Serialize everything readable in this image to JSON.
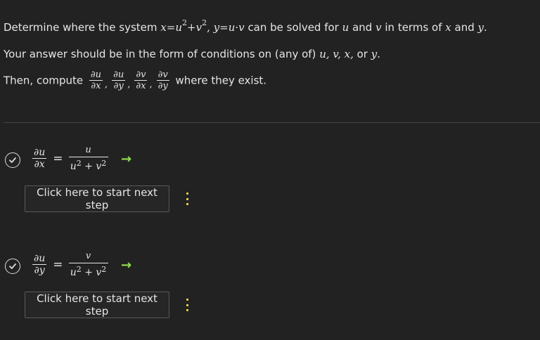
{
  "problem": {
    "line1": {
      "t1": "Determine where the system",
      "m1": "x",
      "m2": "=",
      "m3": "u",
      "exp": "2",
      "m4": "+",
      "m5": "v",
      "exp2": "2",
      "m6": ",",
      "m7": "y",
      "m8": "=",
      "m9": "u",
      "m10": "·",
      "m11": "v",
      "t2": "can be solved for",
      "mu": "u",
      "t3": "and",
      "mv": "v",
      "t4": "in terms of",
      "mx": "x",
      "t5": "and",
      "my": "y",
      "t6": "."
    },
    "line2": {
      "t1": "Your answer should be in the form of conditions on (any of)",
      "vars": "u, v, x,",
      "t2": "or",
      "my": "y",
      "t3": "."
    },
    "line3": {
      "t1": "Then, compute",
      "d1": {
        "num": "∂u",
        "den": "∂x"
      },
      "d2": {
        "num": "∂u",
        "den": "∂y"
      },
      "d3": {
        "num": "∂v",
        "den": "∂x"
      },
      "d4": {
        "num": "∂v",
        "den": "∂y"
      },
      "comma": ",",
      "t2": "where they exist."
    }
  },
  "steps": [
    {
      "lhs": {
        "num": "∂u",
        "den": "∂x"
      },
      "eq": "=",
      "rhs": {
        "num": "u",
        "den_a": "u",
        "den_exp": "2",
        "den_plus": " + v",
        "den_exp2": "2"
      },
      "arrow": "→",
      "next_label": "Click here to start next step"
    },
    {
      "lhs": {
        "num": "∂u",
        "den": "∂y"
      },
      "eq": "=",
      "rhs": {
        "num": "v",
        "den_a": "u",
        "den_exp": "2",
        "den_plus": " + v",
        "den_exp2": "2"
      },
      "arrow": "→",
      "next_label": "Click here to start next step"
    }
  ],
  "colors": {
    "background": "#222222",
    "text": "#e6e6e6",
    "arrow": "#8fe34a",
    "menu_dots": "#f2d94e"
  },
  "icons": {
    "check": "check-circle-icon",
    "arrow": "arrow-right-icon",
    "menu": "vertical-dots-icon"
  }
}
